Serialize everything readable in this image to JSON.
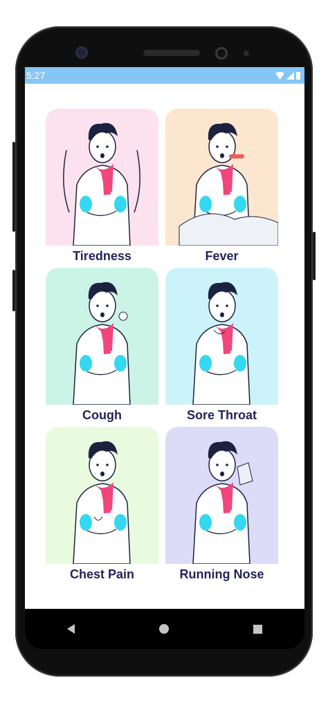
{
  "status": {
    "time": "5:27"
  },
  "symptoms": [
    {
      "label": "Tiredness",
      "bg": "#fce2ee",
      "icon": "tiredness-illustration"
    },
    {
      "label": "Fever",
      "bg": "#fde6cf",
      "icon": "fever-illustration"
    },
    {
      "label": "Cough",
      "bg": "#cbf4e7",
      "icon": "cough-illustration"
    },
    {
      "label": "Sore Throat",
      "bg": "#cdf3fa",
      "icon": "sore-throat-illustration"
    },
    {
      "label": "Chest Pain",
      "bg": "#e8fbde",
      "icon": "chest-pain-illustration"
    },
    {
      "label": "Running Nose",
      "bg": "#dcdcf8",
      "icon": "running-nose-illustration"
    }
  ],
  "colors": {
    "statusbar": "#86c6f5",
    "label": "#22235a",
    "scarf": "#f0467c",
    "hair": "#1c2140",
    "accent": "#34d8f0"
  }
}
